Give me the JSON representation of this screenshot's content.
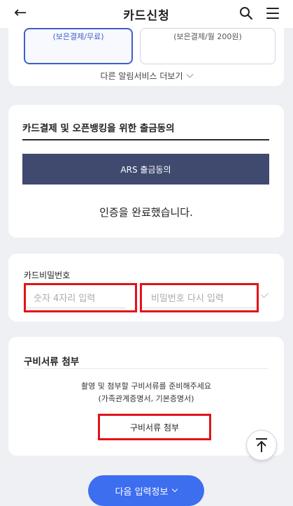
{
  "header": {
    "back_icon": "arrow-left-icon",
    "title": "카드신청",
    "search_icon": "search-icon",
    "menu_icon": "hamburger-menu-icon"
  },
  "alert_service": {
    "option1": "(보은결제/무료)",
    "option2": "(보은결제/월 200원)",
    "more_link": "다른 알림서비스 더보기"
  },
  "withdrawal": {
    "heading": "카드결제 및 오픈뱅킹을 위한 출금동의",
    "ars_button": "ARS 출금동의",
    "status": "인증을 완료했습니다."
  },
  "card_password": {
    "label": "카드비밀번호",
    "field1_placeholder": "숫자 4자리 입력",
    "field2_placeholder": "비밀번호 다시 입력"
  },
  "documents": {
    "heading": "구비서류 첨부",
    "instruction_line1": "촬영 및 첨부할 구비서류를 준비해주세요",
    "instruction_line2": "(가족관계증명서, 기본증명서)",
    "attach_button": "구비서류 첨부"
  },
  "scroll_top_icon": "arrow-up-icon",
  "next_button": "다음 입력정보",
  "colors": {
    "accent": "#3d6ef0",
    "ars_button": "#3f4a6e",
    "highlight_red": "#e3121a"
  }
}
